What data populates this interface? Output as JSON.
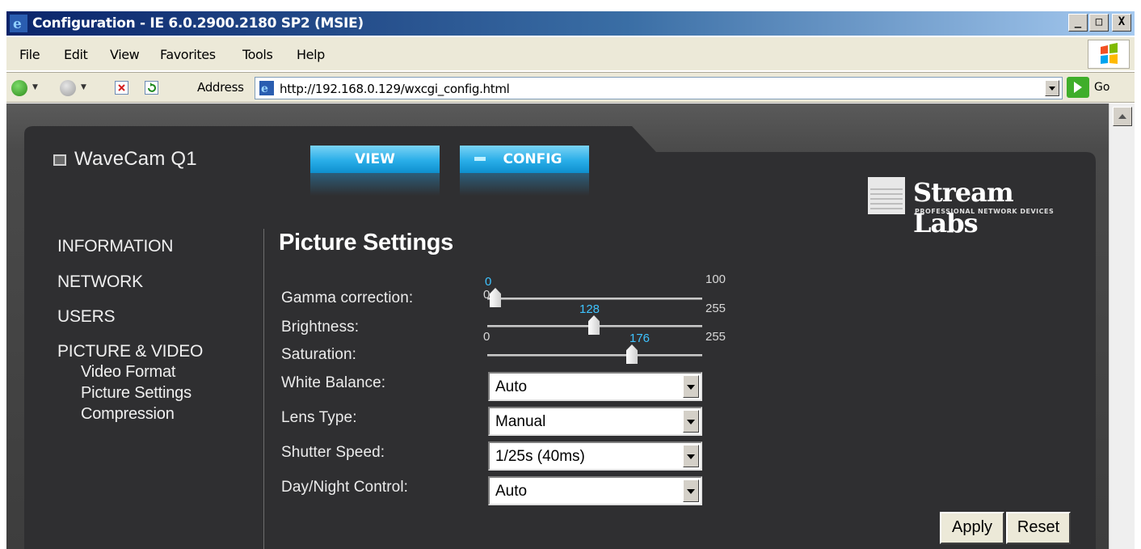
{
  "window": {
    "title": "Configuration - IE 6.0.2900.2180 SP2 (MSIE)",
    "controls": {
      "minimize": "_",
      "maximize": "□",
      "close": "X"
    }
  },
  "menubar": {
    "items": [
      "File",
      "Edit",
      "View",
      "Favorites",
      "Tools",
      "Help"
    ]
  },
  "addressbar": {
    "label": "Address",
    "url": "http://192.168.0.129/wxcgi_config.html",
    "go_label": "Go"
  },
  "app": {
    "product_name": "WaveCam Q1",
    "tabs": [
      {
        "label": "VIEW",
        "active": false
      },
      {
        "label": "CONFIG",
        "active": true
      }
    ],
    "logo": {
      "name": "Stream Labs",
      "tagline": "PROFESSIONAL NETWORK DEVICES"
    }
  },
  "nav": {
    "items": [
      "INFORMATION",
      "NETWORK",
      "USERS",
      "PICTURE & VIDEO"
    ],
    "subitems": [
      "Video Format",
      "Picture Settings",
      "Compression"
    ]
  },
  "page": {
    "title": "Picture Settings",
    "sliders": [
      {
        "label": "Gamma correction:",
        "value": "0",
        "min": "0",
        "max": "100"
      },
      {
        "label": "Brightness:",
        "value": "128",
        "min": "0",
        "max": "255"
      },
      {
        "label": "Saturation:",
        "value": "176",
        "min": "0",
        "max": "255"
      }
    ],
    "selects": [
      {
        "label": "White Balance:",
        "value": "Auto"
      },
      {
        "label": "Lens Type:",
        "value": "Manual"
      },
      {
        "label": "Shutter Speed:",
        "value": "1/25s (40ms)"
      },
      {
        "label": "Day/Night Control:",
        "value": "Auto"
      }
    ],
    "buttons": {
      "apply": "Apply",
      "reset": "Reset"
    }
  },
  "colors": {
    "titlebar_start": "#0a246a",
    "accent_blue": "#29aee8",
    "slider_value": "#3ec3ff",
    "panel_bg": "#3d3d3d"
  }
}
